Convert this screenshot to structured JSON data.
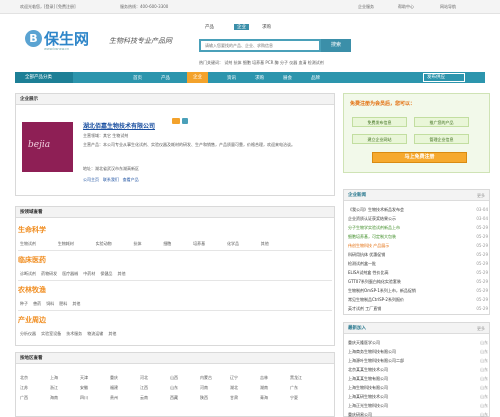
{
  "topbar": {
    "welcome": "欢迎光临您，[登录] [免费注册]",
    "hotline": "服务热线：400-600-3300",
    "links": [
      "企业服务",
      "帮助中心",
      "网站导航"
    ]
  },
  "logo": {
    "icon": "B",
    "text": "保生网",
    "sub": "www.bsnsw.cn",
    "slogan": "生物科技专业产品网"
  },
  "search": {
    "tabs": [
      "产品",
      "企业",
      "求购"
    ],
    "placeholder": "请输入您要找的产品、企业、求购信息",
    "button": "搜索",
    "hot_label": "热门关键词：",
    "hot": [
      "试剂",
      "抗体",
      "细胞",
      "培养基",
      "PCR",
      "酶",
      "分子",
      "仪器",
      "血清",
      "检测试剂"
    ]
  },
  "nav": {
    "all_categories": "全部产品分类",
    "items": [
      "首页",
      "产品",
      "企业",
      "资讯",
      "求购",
      "展会",
      "品牌"
    ],
    "active": "企业",
    "sell": "发布供应"
  },
  "company": {
    "panel_title": "企业展示",
    "name": "湖北佰嘉生物技术有限公司",
    "logo_word": "bejia",
    "info": "主营领域：其它  生物试剂",
    "desc": "主营产品：本公司专业从事生化试剂、实验仪器及耗材的研发、生产和销售，产品质量可靠，价格合理，欢迎来电洽谈。",
    "address": "地址：湖北省武汉市东湖高新区",
    "links": [
      "公司主页",
      "联系我们",
      "查看产品"
    ]
  },
  "login_box": {
    "title": "免费注册为会员后，您可以：",
    "buttons": [
      "免费发布信息",
      "推广您的产品",
      "建立企业网站",
      "管理企业信息"
    ],
    "register": "马上免费注册"
  },
  "news": {
    "title": "企业新闻",
    "more": "更多",
    "items": [
      {
        "t": "《我公司》生物技术新品发布会",
        "d": "03-04"
      },
      {
        "t": "企业资质认证获奖结果公示",
        "d": "03-04"
      },
      {
        "t": "分子生物学实验试剂新品上市",
        "d": "05-29"
      },
      {
        "t": "细胞培养基，可定制大包装",
        "d": "05-29"
      },
      {
        "t": "伟创生物科技 产品展示",
        "d": "05-29"
      },
      {
        "t": "科研用抗体 优惠促销",
        "d": "05-29"
      },
      {
        "t": "检测试剂盒一批",
        "d": "05-29"
      },
      {
        "t": "ELISA试剂盒 性价比高",
        "d": "05-29"
      },
      {
        "t": "GTT07系列蛋白纯化实验套装",
        "d": "05-29"
      },
      {
        "t": "生物制剂OmSP-1系列上市，新品促销",
        "d": "05-29"
      },
      {
        "t": "常见生物制品CtrlSP-2系列报价",
        "d": "05-29"
      },
      {
        "t": "英才试剂 工厂直销",
        "d": "05-29"
      }
    ]
  },
  "categories": {
    "title": "按领域查看",
    "groups": [
      {
        "name": "生命科学",
        "subs": [
          "生物试剂",
          "生物耗材",
          "实验动物",
          "抗体",
          "细胞",
          "培养基",
          "化学品",
          "其他"
        ]
      },
      {
        "name": "临床医药",
        "subs": [
          "诊断试剂",
          "药物研发",
          "医疗器械",
          "中药材",
          "保健品",
          "其他"
        ]
      },
      {
        "name": "农林牧渔",
        "subs": [
          "种子",
          "兽药",
          "饲料",
          "肥料",
          "其他"
        ]
      },
      {
        "name": "产业周边",
        "subs": [
          "分析仪器",
          "实验室设备",
          "技术服务",
          "物流运输",
          "其他"
        ]
      }
    ]
  },
  "regions": {
    "title": "按地区查看",
    "items": [
      "北京",
      "上海",
      "天津",
      "重庆",
      "河北",
      "山西",
      "内蒙古",
      "辽宁",
      "吉林",
      "黑龙江",
      "江苏",
      "浙江",
      "安徽",
      "福建",
      "江西",
      "山东",
      "河南",
      "湖北",
      "湖南",
      "广东",
      "广西",
      "海南",
      "四川",
      "贵州",
      "云南",
      "西藏",
      "陕西",
      "甘肃",
      "青海",
      "宁夏"
    ]
  },
  "recent": {
    "title": "最新加入",
    "more": "更多",
    "items": [
      {
        "t": "重庆天隆医学公司",
        "d": "山东"
      },
      {
        "t": "上海商务生物科技有限公司",
        "d": "山东"
      },
      {
        "t": "上海源叶生物科技有限公司二部",
        "d": "山东"
      },
      {
        "t": "北京某某生物技术公司",
        "d": "山东"
      },
      {
        "t": "上海某某生物有限公司",
        "d": "山东"
      },
      {
        "t": "上海生物科技有限公司",
        "d": "山东"
      },
      {
        "t": "上海某研生物技术公司",
        "d": "山东"
      },
      {
        "t": "上海正光生物科技公司",
        "d": "山东"
      },
      {
        "t": "重庆研易公司",
        "d": "山东"
      }
    ]
  },
  "colors": {
    "brand": "#2c95ad",
    "accent": "#f3a22b",
    "category": "#f08c1e"
  }
}
